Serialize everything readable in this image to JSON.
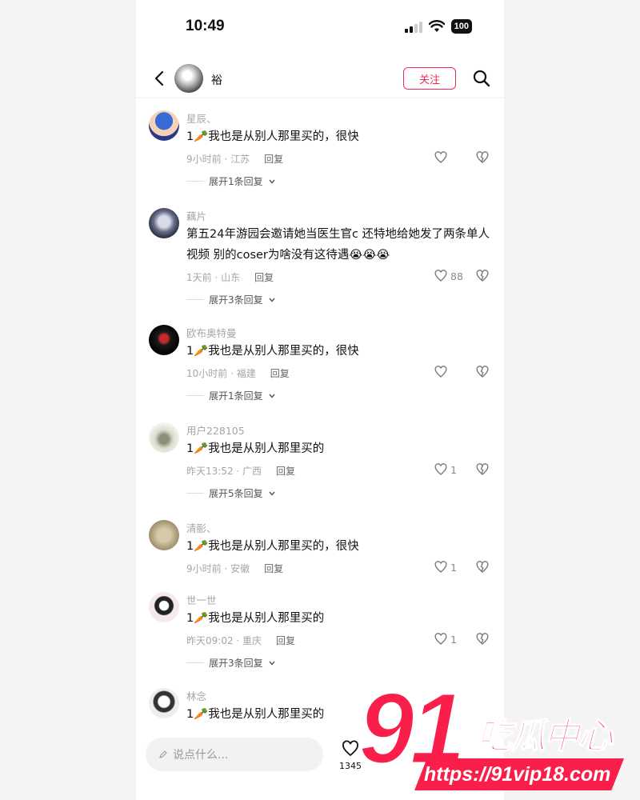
{
  "status": {
    "time": "10:49",
    "battery": "100"
  },
  "header": {
    "name": "裕",
    "follow_label": "关注"
  },
  "comments": [
    {
      "user": "星辰、",
      "text_pre": "1",
      "text_post": "我也是从别人那里买的，很快",
      "meta": "9小时前 · 江苏",
      "reply": "回复",
      "likes": "",
      "expand": "展开1条回复"
    },
    {
      "user": "藕片",
      "text_pre": "",
      "text_post": "第五24年游园会邀请她当医生官c 还特地给她发了两条单人视频 别的coser为啥没有这待遇😭😭😭",
      "meta": "1天前 · 山东",
      "reply": "回复",
      "likes": "88",
      "expand": "展开3条回复"
    },
    {
      "user": "欧布奥特曼",
      "text_pre": "1",
      "text_post": "我也是从别人那里买的，很快",
      "meta": "10小时前 · 福建",
      "reply": "回复",
      "likes": "",
      "expand": "展开1条回复"
    },
    {
      "user": "用户228105",
      "text_pre": "1",
      "text_post": "我也是从别人那里买的",
      "meta": "昨天13:52 · 广西",
      "reply": "回复",
      "likes": "1",
      "expand": "展开5条回复"
    },
    {
      "user": "清彨、",
      "text_pre": "1",
      "text_post": "我也是从别人那里买的，很快",
      "meta": "9小时前 · 安徽",
      "reply": "回复",
      "likes": "1",
      "expand": ""
    },
    {
      "user": "世一世",
      "text_pre": "1",
      "text_post": "我也是从别人那里买的",
      "meta": "昨天09:02 · 重庆",
      "reply": "回复",
      "likes": "1",
      "expand": "展开3条回复"
    },
    {
      "user": "林念",
      "text_pre": "1",
      "text_post": "我也是从别人那里买的",
      "meta": "",
      "reply": "",
      "likes": "",
      "expand": ""
    }
  ],
  "bottom": {
    "placeholder": "说点什么...",
    "like_count": "1345"
  },
  "watermark": {
    "big": "91",
    "brand": "吃瓜中心",
    "url": "https://91vip18.com"
  },
  "colors": {
    "accent": "#ee2b54",
    "watermark": "#fa1e4b",
    "carrot": "#ff7a1a"
  },
  "icons": {
    "carrot": "carrot-emoji",
    "cry": "loudly-crying-emoji"
  }
}
